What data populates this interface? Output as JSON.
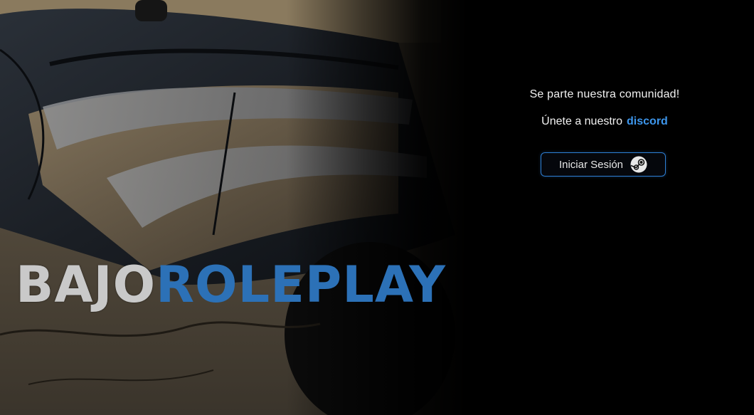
{
  "logo": {
    "part1": "Bajo",
    "part2": "Roleplay"
  },
  "community": {
    "tagline": "Se parte nuestra comunidad!",
    "discord_prefix": "Únete a nuestro",
    "discord_link": "discord"
  },
  "login": {
    "label": "Iniciar Sesión",
    "icon": "steam-icon"
  },
  "colors": {
    "background": "#000000",
    "accent_blue": "#2c71b7",
    "link_blue": "#3d96ec",
    "button_border": "#2e7fd4",
    "logo_gray": "#c9c9c9"
  }
}
